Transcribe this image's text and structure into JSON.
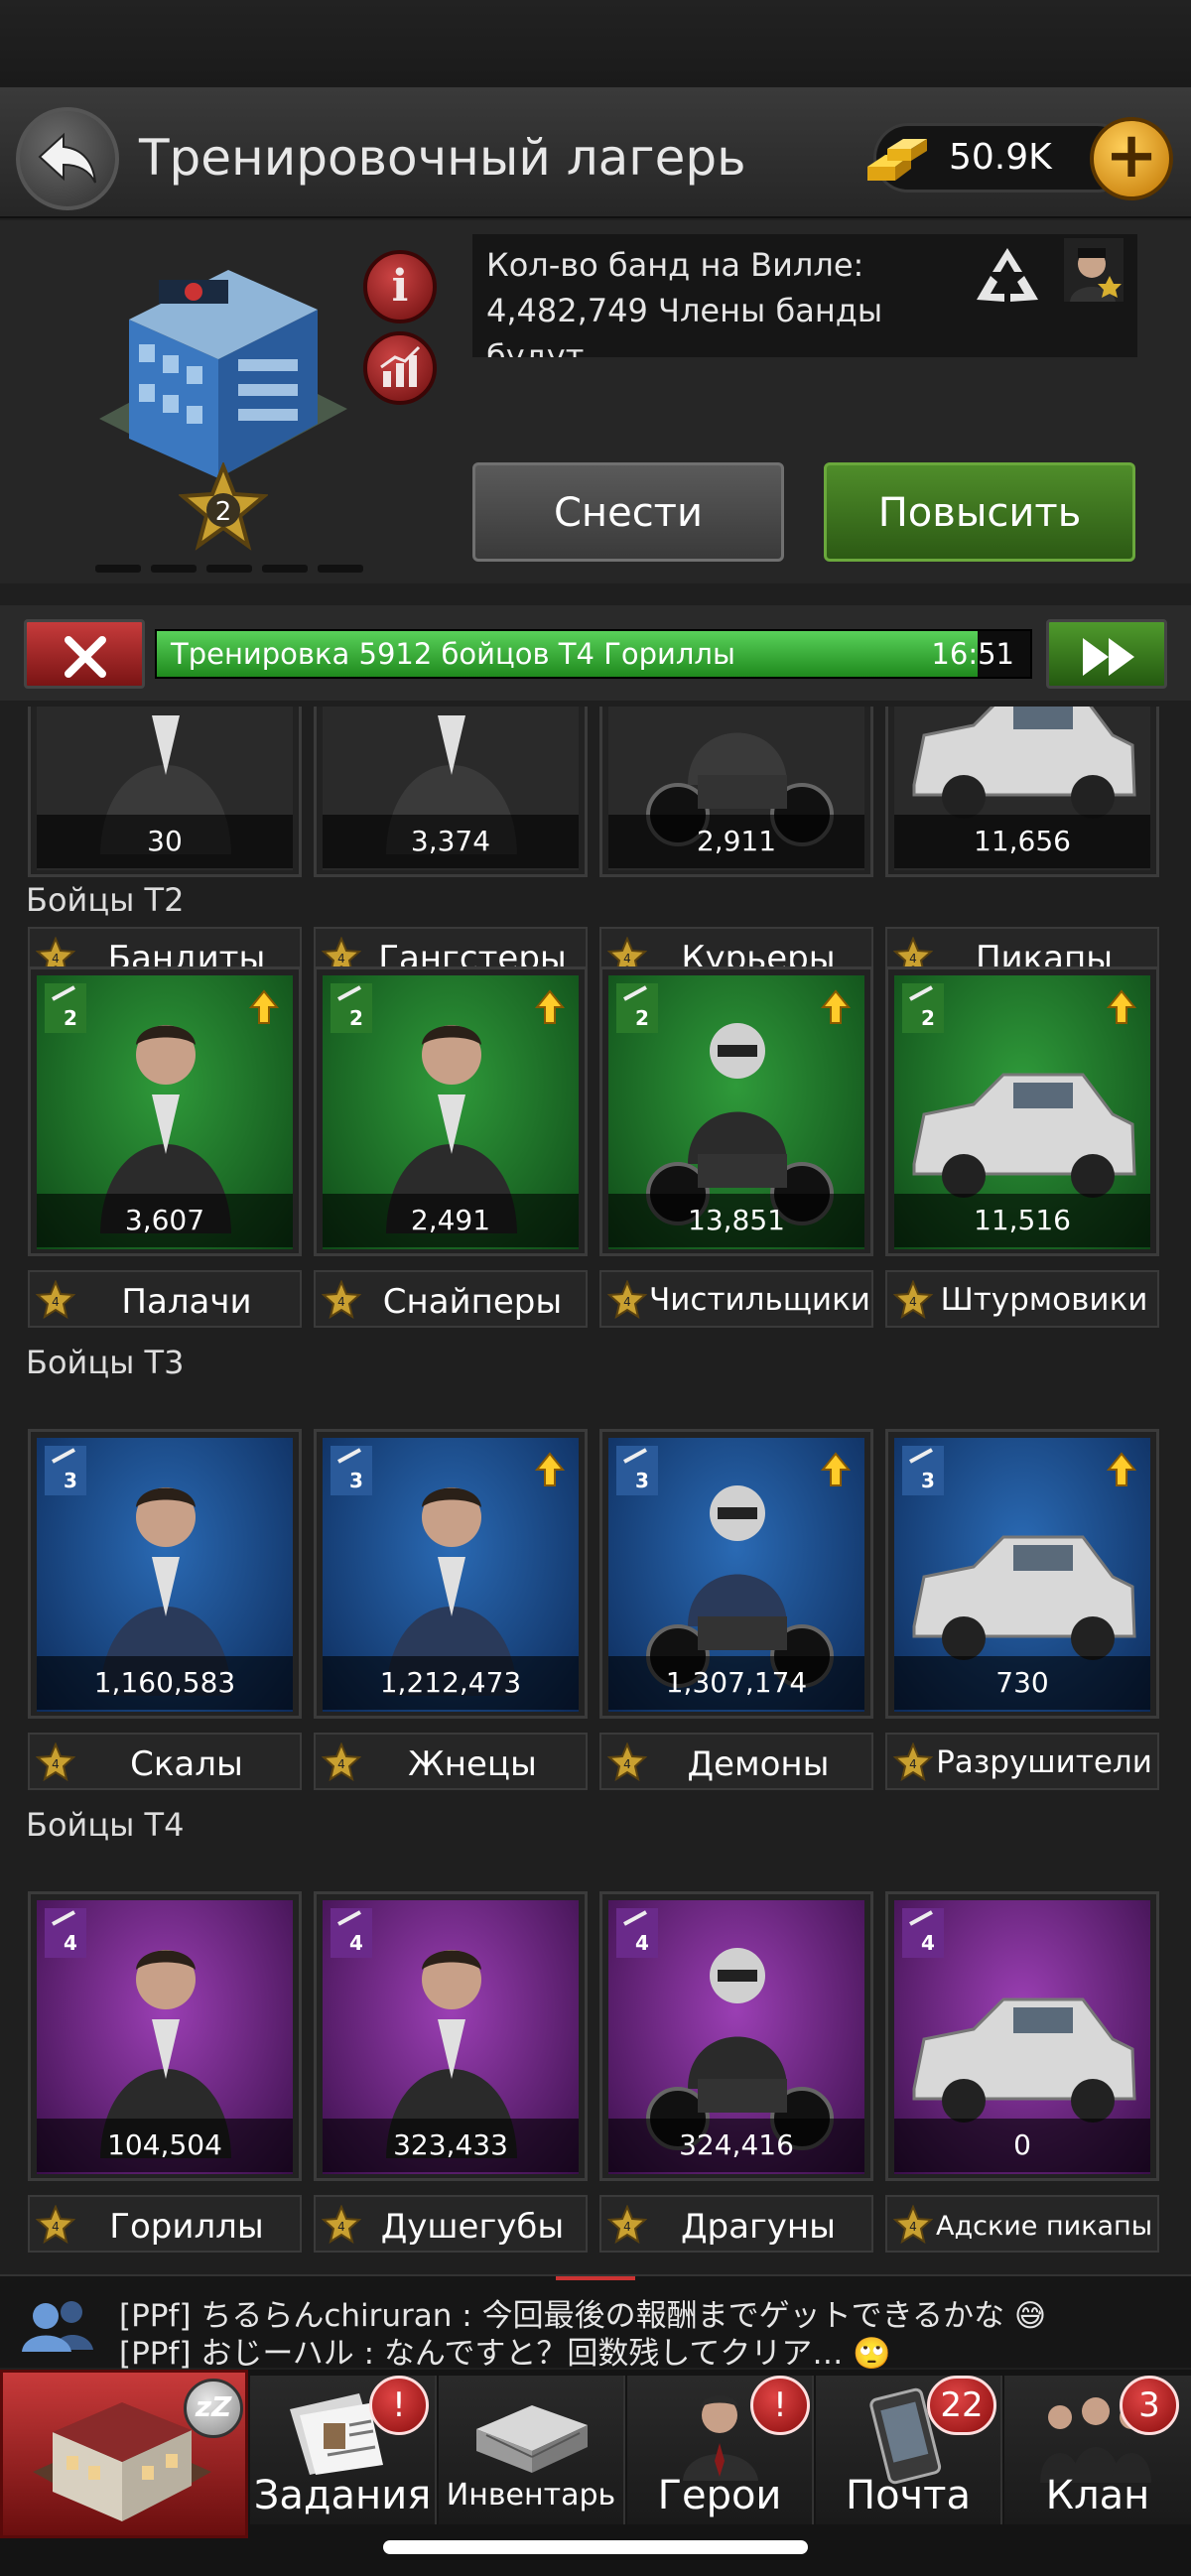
{
  "header": {
    "title": "Тренировочный лагерь",
    "gold": "50.9K"
  },
  "building": {
    "level": "2",
    "description": "Кол-во банд на Вилле: 4,482,749 Члены банды будут",
    "demolish_label": "Снести",
    "upgrade_label": "Повысить"
  },
  "training": {
    "text": "Тренировка 5912 бойцов T4 Гориллы",
    "time": "16:51",
    "progress": 0.94
  },
  "tier1": {
    "units": [
      {
        "count": "30",
        "name": "Бандиты"
      },
      {
        "count": "3,374",
        "name": "Гангстеры"
      },
      {
        "count": "2,911",
        "name": "Курьеры"
      },
      {
        "count": "11,656",
        "name": "Пикапы"
      }
    ]
  },
  "tier2": {
    "title": "Бойцы T2",
    "units": [
      {
        "count": "3,607",
        "name": "Палачи"
      },
      {
        "count": "2,491",
        "name": "Снайперы"
      },
      {
        "count": "13,851",
        "name": "Чистильщики"
      },
      {
        "count": "11,516",
        "name": "Штурмовики"
      }
    ]
  },
  "tier3": {
    "title": "Бойцы T3",
    "units": [
      {
        "count": "1,160,583",
        "name": "Скалы"
      },
      {
        "count": "1,212,473",
        "name": "Жнецы"
      },
      {
        "count": "1,307,174",
        "name": "Демоны"
      },
      {
        "count": "730",
        "name": "Разрушители"
      }
    ]
  },
  "tier4": {
    "title": "Бойцы T4",
    "units": [
      {
        "count": "104,504",
        "name": "Гориллы"
      },
      {
        "count": "323,433",
        "name": "Душегубы"
      },
      {
        "count": "324,416",
        "name": "Драгуны"
      },
      {
        "count": "0",
        "name": "Адские пикапы"
      }
    ]
  },
  "chat": {
    "line1": "[PPf] ちるらんchiruran : 今回最後の報酬までゲットできるかな 😅",
    "line2": "[PPf] おじーハル : なんですと？回数残してクリア… 🙄"
  },
  "nav": {
    "tasks": "Задания",
    "tasks_badge": "!",
    "inventory": "Инвентарь",
    "heroes": "Герои",
    "heroes_badge": "!",
    "mail": "Почта",
    "mail_badge": "22",
    "clan": "Клан",
    "clan_badge": "3",
    "home_sleep": "zZ"
  }
}
